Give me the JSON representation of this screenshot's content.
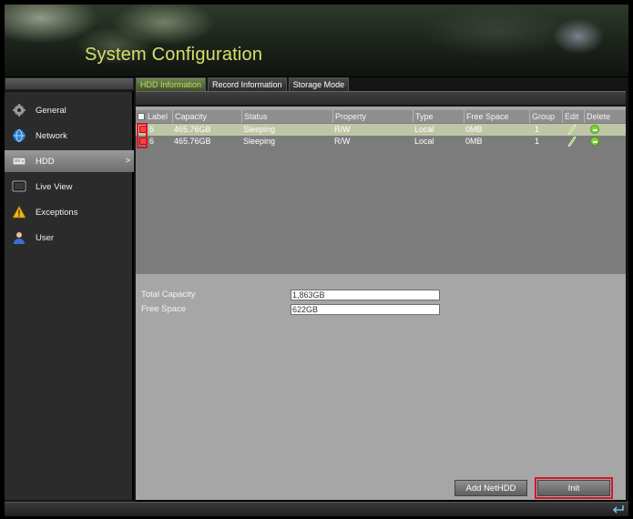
{
  "window": {
    "title": "System Configuration"
  },
  "sidebar": {
    "items": [
      {
        "label": "General",
        "icon": "gear-icon"
      },
      {
        "label": "Network",
        "icon": "globe-icon"
      },
      {
        "label": "HDD",
        "icon": "hdd-icon",
        "active": true,
        "arrow": ">"
      },
      {
        "label": "Live View",
        "icon": "monitor-icon"
      },
      {
        "label": "Exceptions",
        "icon": "warning-icon"
      },
      {
        "label": "User",
        "icon": "user-icon"
      }
    ]
  },
  "tabs": [
    {
      "label": "HDD Information",
      "active": true
    },
    {
      "label": "Record Information",
      "active": false
    },
    {
      "label": "Storage Mode",
      "active": false
    }
  ],
  "table": {
    "columns": [
      "Label",
      "Capacity",
      "Status",
      "Property",
      "Type",
      "Free Space",
      "Group",
      "Edit",
      "Delete"
    ],
    "rows": [
      {
        "label": "5",
        "capacity": "465.76GB",
        "status": "Sleeping",
        "property": "R/W",
        "type": "Local",
        "free_space": "0MB",
        "group": "1",
        "selected": true
      },
      {
        "label": "6",
        "capacity": "465.76GB",
        "status": "Sleeping",
        "property": "R/W",
        "type": "Local",
        "free_space": "0MB",
        "group": "1",
        "selected": false
      }
    ]
  },
  "summary": {
    "total_capacity_label": "Total Capacity",
    "total_capacity_value": "1,863GB",
    "free_space_label": "Free Space",
    "free_space_value": "622GB"
  },
  "buttons": {
    "add_nethdd": "Add NetHDD",
    "init": "Init"
  },
  "colors": {
    "title": "#d8e06a",
    "active_tab": "#c8d86a",
    "highlight": "#d6162c",
    "delete_icon": "#7bd630"
  }
}
